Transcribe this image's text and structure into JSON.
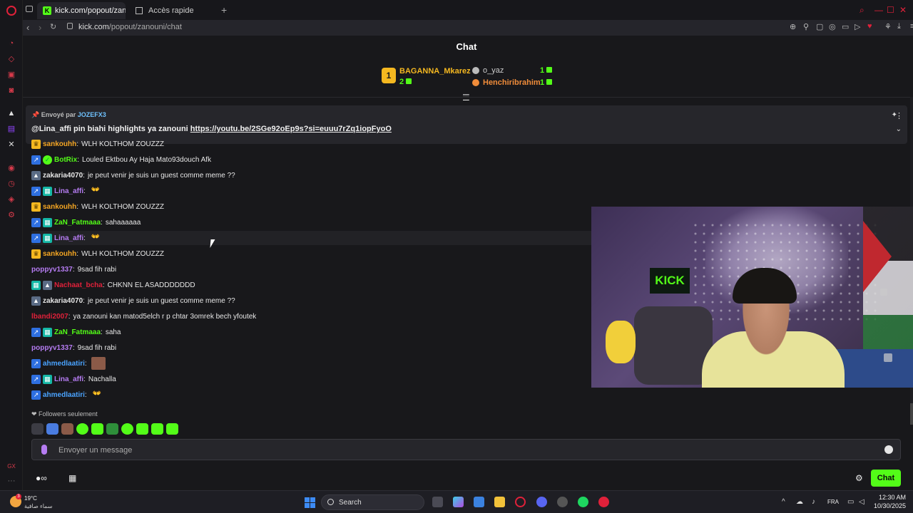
{
  "browser": {
    "active_tab_title": "kick.com/popout/zanouni",
    "inactive_tab_title": "Accès rapide",
    "url_host": "kick.com",
    "url_path": "/popout/zanouni/chat"
  },
  "chat": {
    "title": "Chat",
    "leaderboard": [
      {
        "rank": "1",
        "name": "BAGANNA_Mkarez",
        "count": "2"
      },
      {
        "name": "o_yaz",
        "count": "1"
      },
      {
        "name": "Henchiribrahim",
        "count": "1"
      }
    ],
    "pinned": {
      "sent_by_label": "Envoyé par",
      "sender": "JOZEFX3",
      "text_prefix": "@Lina_affi pin biahi highlights ya zanouni ",
      "link": "https://youtu.be/2SGe92oEp9s?si=euuu7rZq1iopFyoO"
    },
    "messages": [
      {
        "user": "sankouhh",
        "color": "#f5a623",
        "badges": [
          "gold"
        ],
        "text": "WLH KOLTHOM ZOUZZZ",
        "hl": false
      },
      {
        "user": "BotRix",
        "color": "#53fc18",
        "badges": [
          "blue",
          "green"
        ],
        "text": "Louled Ektbou Ay Haja Mato93douch Afk",
        "hl": false
      },
      {
        "user": "zakaria4070",
        "color": "#e6e6e6",
        "badges": [
          "snow"
        ],
        "text": "je peut venir je suis un guest comme meme ??",
        "hl": false
      },
      {
        "user": "Lina_affi",
        "color": "#b57cf2",
        "badges": [
          "blue",
          "teal"
        ],
        "text": "",
        "emote": true,
        "hl": false
      },
      {
        "user": "sankouhh",
        "color": "#f5a623",
        "badges": [
          "gold"
        ],
        "text": "WLH KOLTHOM ZOUZZZ",
        "hl": false
      },
      {
        "user": "ZaN_Fatmaaa",
        "color": "#53fc18",
        "badges": [
          "blue",
          "teal"
        ],
        "text": "sahaaaaaa",
        "hl": false
      },
      {
        "user": "Lina_affi",
        "color": "#b57cf2",
        "badges": [
          "blue",
          "teal"
        ],
        "text": "",
        "emote": true,
        "hl": true
      },
      {
        "user": "sankouhh",
        "color": "#f5a623",
        "badges": [
          "gold"
        ],
        "text": "WLH KOLTHOM ZOUZZZ",
        "hl": false
      },
      {
        "user": "poppyv1337",
        "color": "#b57cf2",
        "badges": [],
        "text": "9sad fih rabi",
        "hl": false
      },
      {
        "user": "Nachaat_bcha",
        "color": "#e0213a",
        "badges": [
          "teal",
          "snow"
        ],
        "text": "CHKNN EL ASADDDDDDD",
        "hl": false
      },
      {
        "user": "zakaria4070",
        "color": "#e6e6e6",
        "badges": [
          "snow"
        ],
        "text": "je peut venir je suis un guest comme meme ??",
        "hl": false
      },
      {
        "user": "lbandi2007",
        "color": "#e0213a",
        "badges": [],
        "text": "ya zanouni kan matod5elch r p chtar 3omrek bech yfoutek",
        "hl": false
      },
      {
        "user": "ZaN_Fatmaaa",
        "color": "#53fc18",
        "badges": [
          "blue",
          "teal"
        ],
        "text": "saha",
        "hl": false
      },
      {
        "user": "poppyv1337",
        "color": "#b57cf2",
        "badges": [],
        "text": "9sad fih rabi",
        "hl": false
      },
      {
        "user": "ahmedlaatiri",
        "color": "#4aa3ff",
        "badges": [
          "blue"
        ],
        "text": "",
        "emote_img": true,
        "hl": false
      },
      {
        "user": "Lina_affi",
        "color": "#b57cf2",
        "badges": [
          "blue",
          "teal"
        ],
        "text": "Nachalla",
        "hl": false
      },
      {
        "user": "ahmedlaatiri",
        "color": "#4aa3ff",
        "badges": [
          "blue"
        ],
        "text": "",
        "emote": true,
        "hl": false
      }
    ],
    "followers_label": "Followers seulement",
    "input_placeholder": "Envoyer un message",
    "send_label": "Chat"
  },
  "taskbar": {
    "temperature": "19°C",
    "condition": "سماء صافية",
    "search_label": "Search",
    "language": "FRA",
    "time": "12:30 AM",
    "date": "10/30/2025"
  },
  "colors": {
    "kick_green": "#53fc18",
    "opera_red": "#e0213a",
    "gold": "#f5b820"
  }
}
